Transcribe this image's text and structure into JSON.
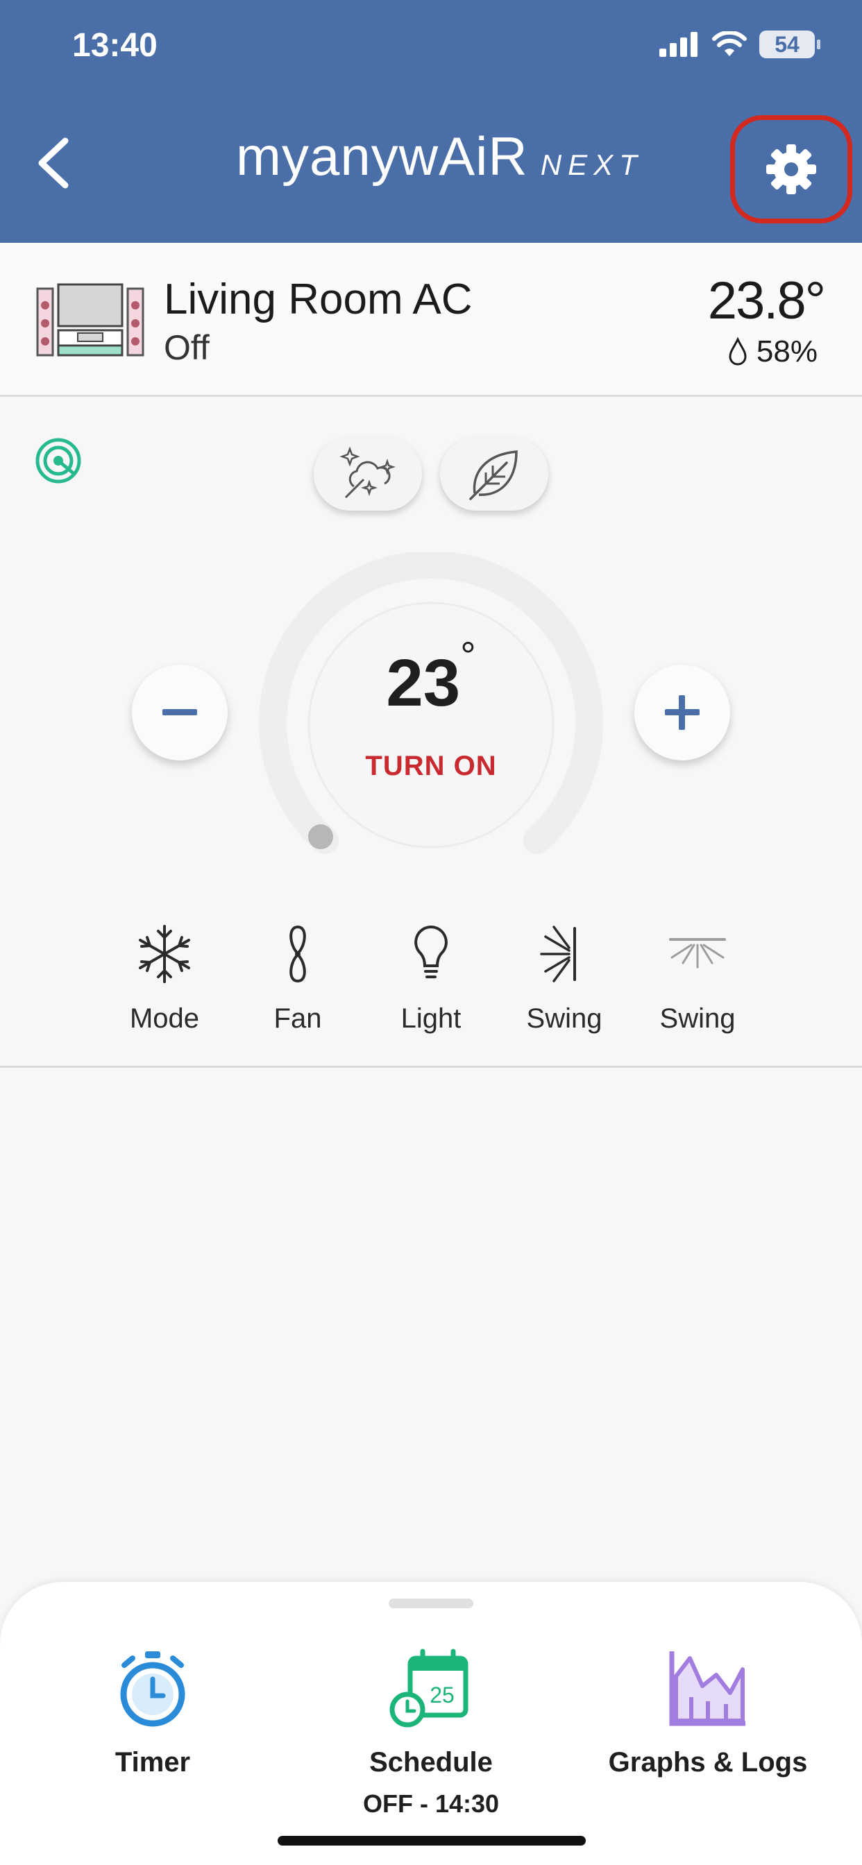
{
  "status_bar": {
    "time": "13:40",
    "battery": "54"
  },
  "header": {
    "brand_main": "myanywAiR",
    "brand_sub": "NEXT"
  },
  "device": {
    "name": "Living Room AC",
    "state": "Off",
    "current_temp": "23.8°",
    "humidity": "58%"
  },
  "controls": {
    "setpoint": "23",
    "degree": "°",
    "power_label": "TURN ON"
  },
  "quick_actions": [
    {
      "label": "Mode",
      "icon": "snowflake-icon"
    },
    {
      "label": "Fan",
      "icon": "fan-blade-icon"
    },
    {
      "label": "Light",
      "icon": "lightbulb-icon"
    },
    {
      "label": "Swing",
      "icon": "vertical-swing-icon"
    },
    {
      "label": "Swing",
      "icon": "horizontal-swing-icon"
    }
  ],
  "bottom_sheet": {
    "timer": {
      "label": "Timer",
      "icon": "stopwatch-icon"
    },
    "schedule": {
      "label": "Schedule",
      "sub": "OFF - 14:30",
      "icon": "calendar-icon",
      "day": "25"
    },
    "graphs": {
      "label": "Graphs & Logs",
      "icon": "chart-icon"
    }
  },
  "colors": {
    "header": "#4a6ea8",
    "power_off": "#c82a2f",
    "highlight": "#d3291e",
    "timer": "#2a8bd8",
    "schedule": "#1bb57a",
    "graphs": "#a27de0"
  }
}
